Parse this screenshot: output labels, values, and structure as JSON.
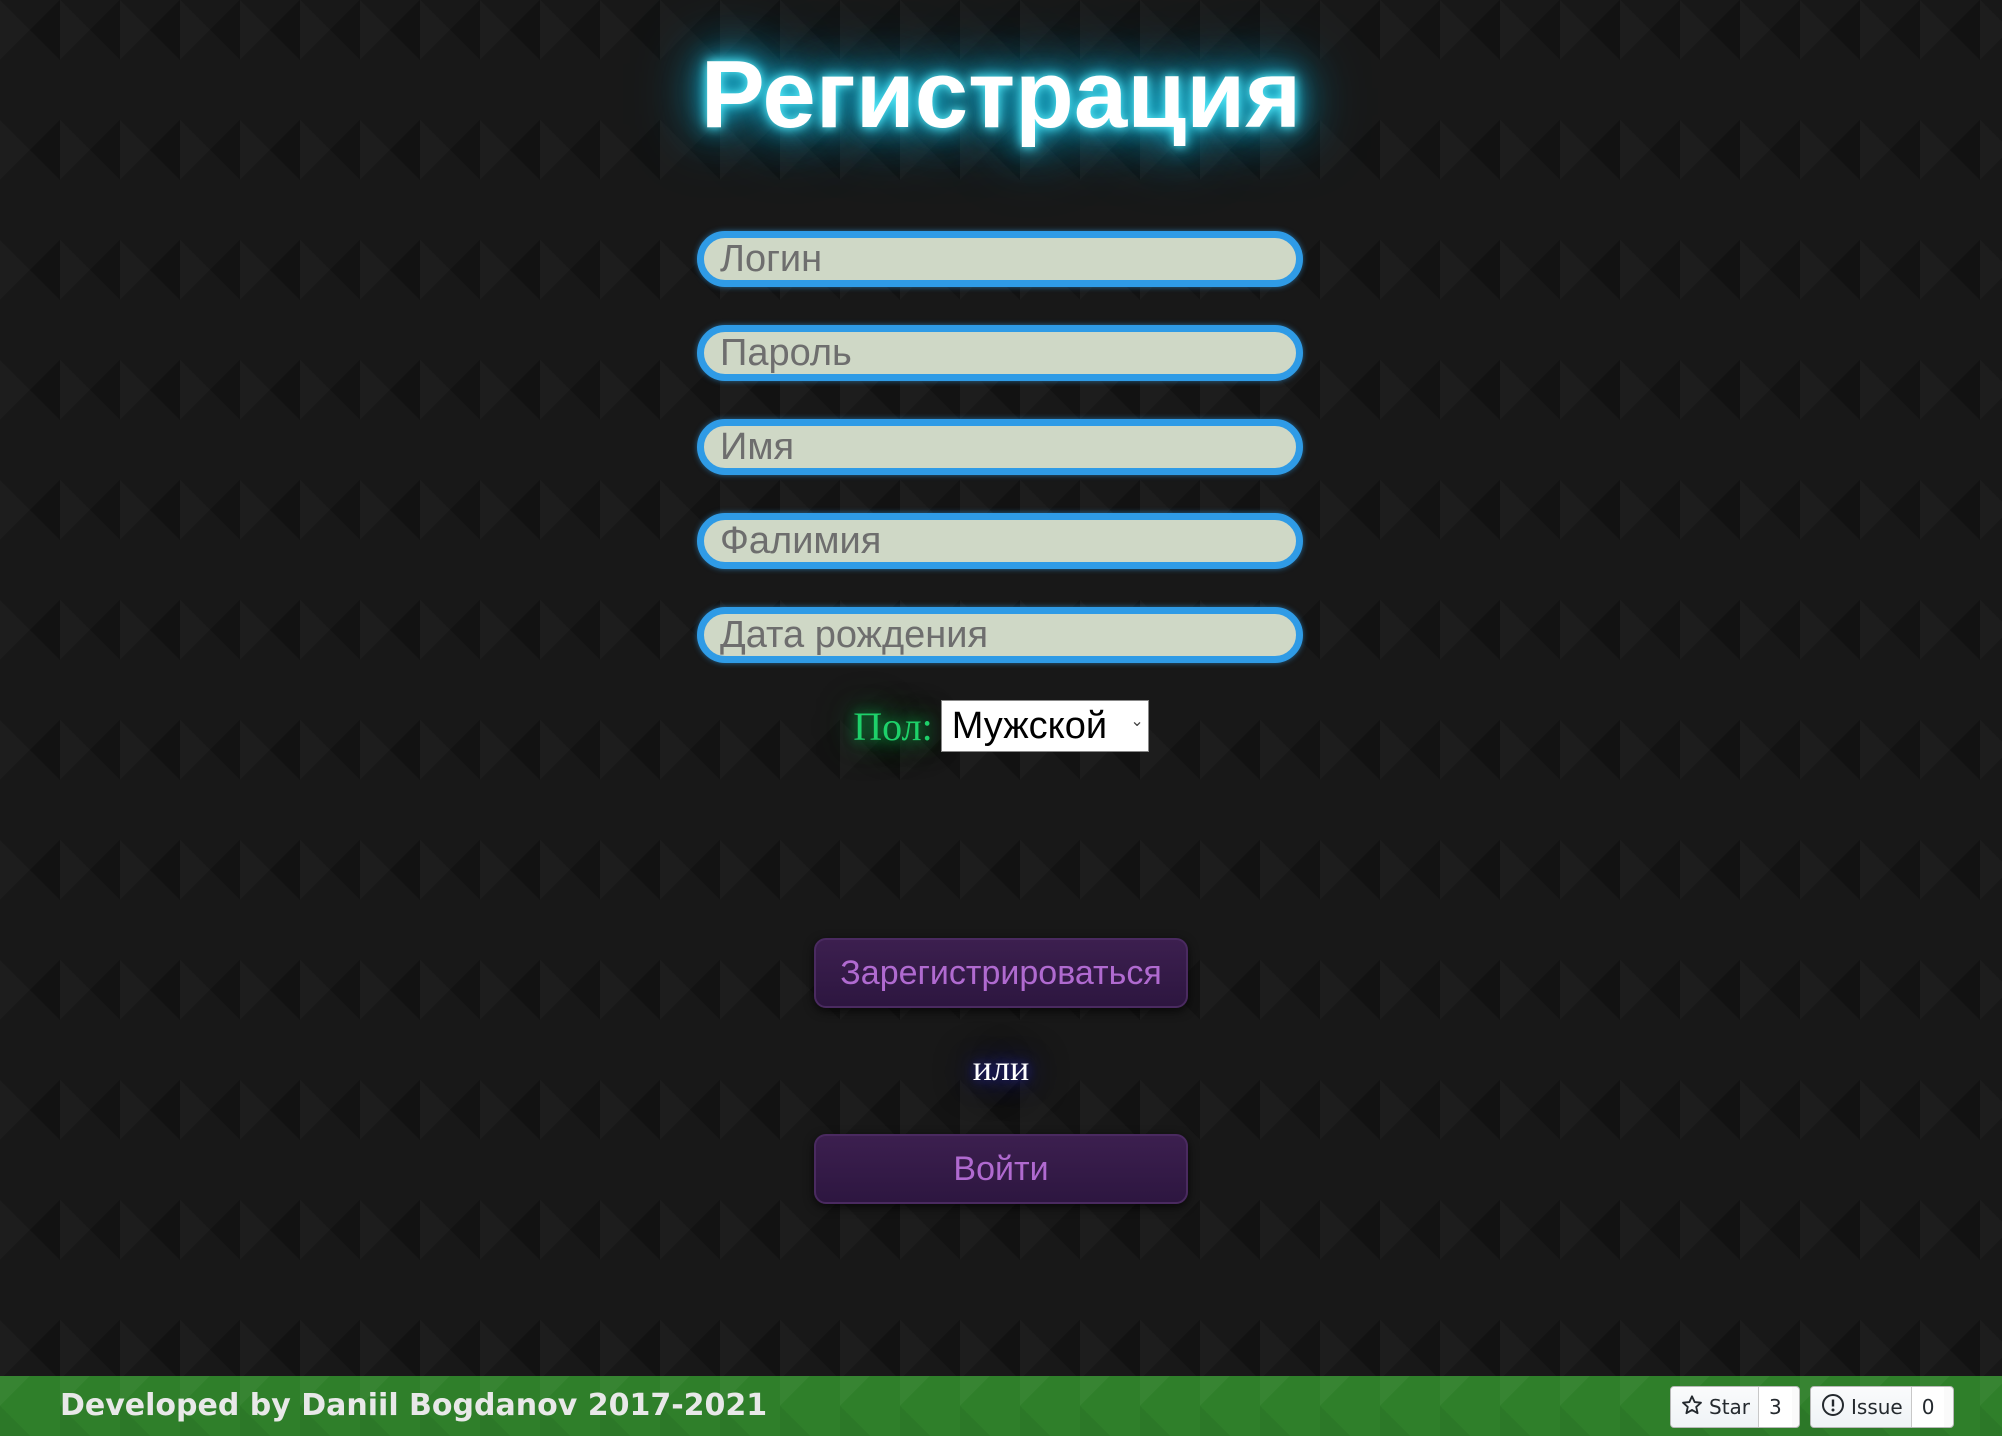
{
  "title": "Регистрация",
  "form": {
    "login_placeholder": "Логин",
    "password_placeholder": "Пароль",
    "name_placeholder": "Имя",
    "surname_placeholder": "Фалимия",
    "birthdate_placeholder": "Дата рождения",
    "gender_label": "Пол:",
    "gender_selected": "Мужской"
  },
  "buttons": {
    "register_label": "Зарегистрироваться",
    "or_text": "или",
    "login_label": "Войти"
  },
  "footer": {
    "credit": "Developed by Daniil Bogdanov 2017-2021",
    "star_label": "Star",
    "star_count": "3",
    "issue_label": "Issue",
    "issue_count": "0"
  },
  "colors": {
    "title_glow": "#1fc9ec",
    "field_border": "#2f9be6",
    "field_bg": "#cfd8c6",
    "gender_label": "#1ed16a",
    "button_bg": "#3c1f4f",
    "button_text": "#b06ad0",
    "footer_bg": "#2f7f2a"
  },
  "icons": {
    "star": "star-icon",
    "issue": "issue-icon",
    "select": "chevron-down-icon"
  }
}
